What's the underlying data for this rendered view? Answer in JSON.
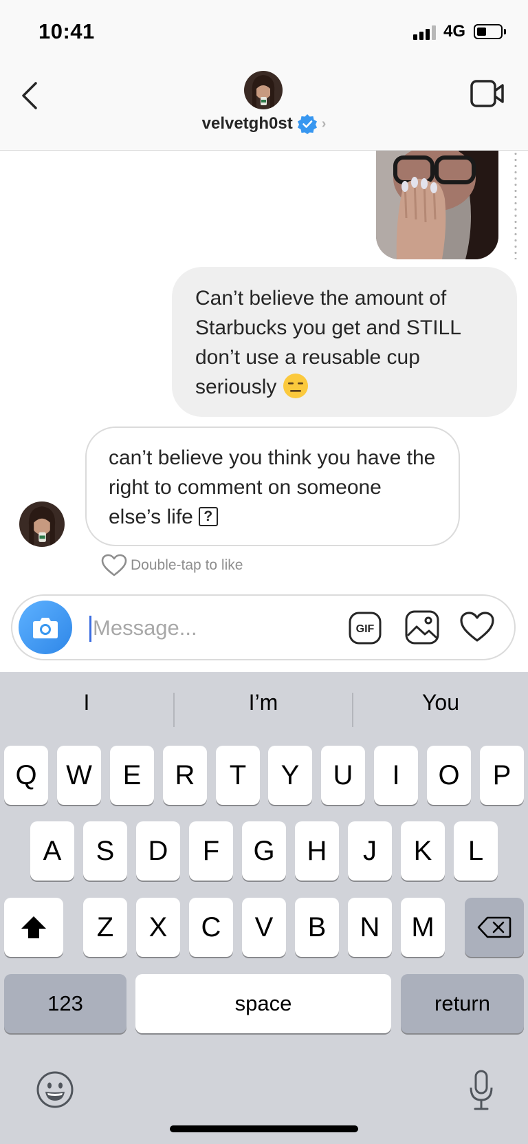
{
  "status_bar": {
    "time": "10:41",
    "network": "4G",
    "battery_level": 0.4
  },
  "header": {
    "username": "velvetgh0st",
    "back_icon": "chevron-left-icon",
    "video_icon": "video-camera-icon",
    "verified_icon": "verified-badge-icon"
  },
  "messages": [
    {
      "from": "me",
      "type": "photo",
      "description_icon": "photo-thumbnail"
    },
    {
      "from": "me",
      "type": "text",
      "text": "Can’t believe the amount of Starbucks you get and STILL don’t use a reusable cup seriously",
      "emoji": "expressionless-face"
    },
    {
      "from": "them",
      "type": "text",
      "text": "can’t believe you think you have the right to comment on someone else’s life",
      "unknown_glyph": "?"
    }
  ],
  "like_hint": "Double-tap to like",
  "composer": {
    "placeholder": "Message...",
    "gif_label": "GIF"
  },
  "keyboard": {
    "suggestions": [
      "I",
      "I’m",
      "You"
    ],
    "row1": [
      "Q",
      "W",
      "E",
      "R",
      "T",
      "Y",
      "U",
      "I",
      "O",
      "P"
    ],
    "row2": [
      "A",
      "S",
      "D",
      "F",
      "G",
      "H",
      "J",
      "K",
      "L"
    ],
    "row3": [
      "Z",
      "X",
      "C",
      "V",
      "B",
      "N",
      "M"
    ],
    "numbers_label": "123",
    "space_label": "space",
    "return_label": "return"
  },
  "colors": {
    "accent_blue": "#3897f0",
    "bubble_gray": "#efefef",
    "keyboard_bg": "#d1d3d9"
  }
}
